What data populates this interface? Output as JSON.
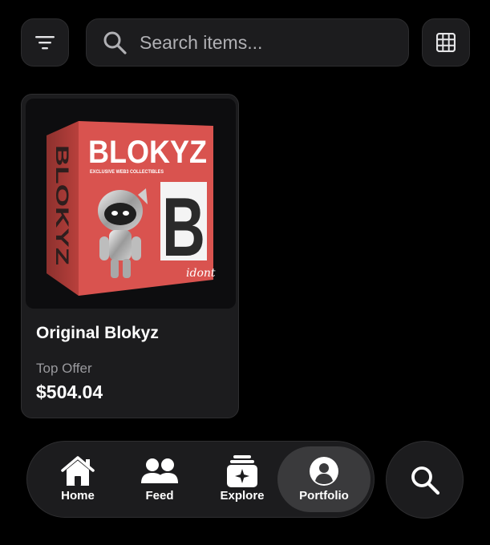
{
  "search": {
    "placeholder": "Search items..."
  },
  "items": [
    {
      "title": "Original Blokyz",
      "offer_label": "Top Offer",
      "price": "$504.04",
      "art": {
        "brand": "BLOKYZ",
        "tagline": "EXCLUSIVE WEB3 COLLECTIBLES",
        "side_text": "BLOKYZ",
        "letter": "B",
        "signature": "idont"
      }
    }
  ],
  "tabs": [
    {
      "label": "Home",
      "icon": "house-icon"
    },
    {
      "label": "Feed",
      "icon": "people-icon"
    },
    {
      "label": "Explore",
      "icon": "sparkle-box-icon"
    },
    {
      "label": "Portfolio",
      "icon": "person-circle-icon",
      "active": true
    }
  ],
  "colors": {
    "background": "#000000",
    "surface": "#1c1c1e",
    "active_tab": "#3a3a3c",
    "box_red": "#d9534f"
  }
}
